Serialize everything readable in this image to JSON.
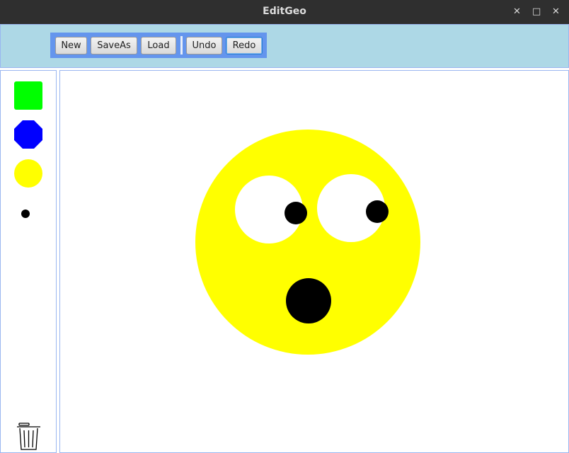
{
  "window": {
    "title": "EditGeo",
    "minimize_icon": "minimize-icon",
    "maximize_icon": "maximize-icon",
    "close_icon": "close-icon"
  },
  "toolbar": {
    "new_label": "New",
    "saveas_label": "SaveAs",
    "load_label": "Load",
    "undo_label": "Undo",
    "redo_label": "Redo"
  },
  "palette": {
    "tools": [
      "rectangle-tool",
      "polygon-tool",
      "circle-tool",
      "small-circle-tool"
    ],
    "colors": {
      "rectangle": "#00ff00",
      "polygon": "#0000ff",
      "circle": "#ffff00",
      "small_circle": "#000000"
    },
    "trash_icon": "trash-icon"
  },
  "canvas": {
    "shapes": [
      "face",
      "left-eye-white",
      "right-eye-white",
      "left-pupil",
      "right-pupil",
      "mouth"
    ],
    "colors": {
      "face": "#ffff00",
      "eye_white": "#ffffff",
      "pupil": "#000000",
      "mouth": "#000000"
    }
  }
}
